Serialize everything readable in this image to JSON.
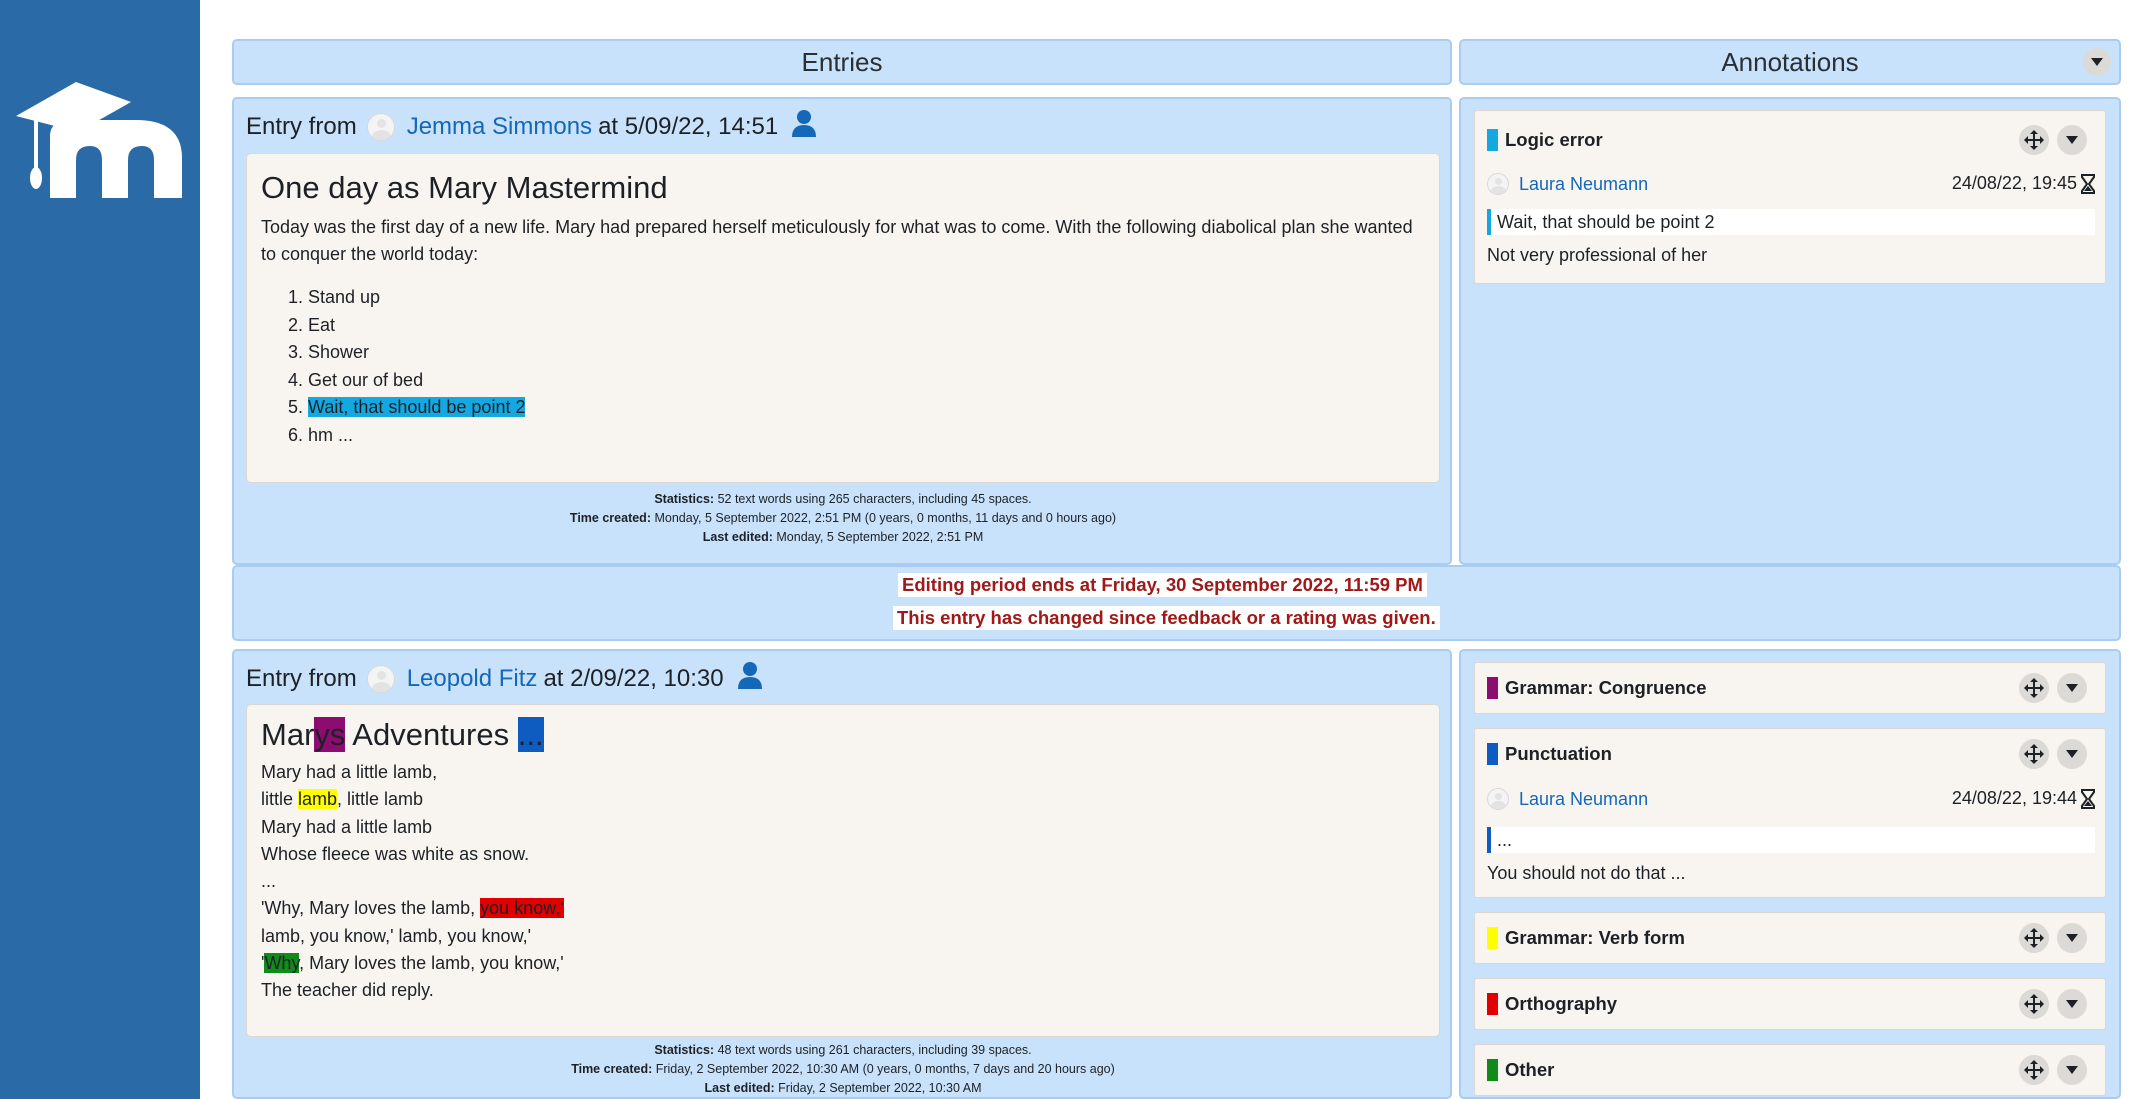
{
  "header": {
    "entries": "Entries",
    "annotations": "Annotations"
  },
  "entry1": {
    "prefix": "Entry from",
    "author": "Jemma Simmons",
    "when": "at 5/09/22, 14:51",
    "title": "One day as Mary Mastermind",
    "intro": "Today was the first day of a new life. Mary had prepared herself meticulously for what was to come. With the following diabolical plan she wanted to conquer the world today:",
    "items": [
      "Stand up",
      "Eat",
      "Shower",
      "Get our of bed",
      "Wait, that should be point 2",
      "hm ..."
    ],
    "stats": {
      "statistics_label": "Statistics:",
      "statistics": "52 text words using 265 characters, including 45 spaces.",
      "created_label": "Time created:",
      "created": "Monday, 5 September 2022, 2:51 PM (0 years, 0 months, 11 days and 0 hours ago)",
      "edited_label": "Last edited:",
      "edited": "Monday, 5 September 2022, 2:51 PM"
    }
  },
  "notices": {
    "editing_period": "Editing period ends at Friday, 30 September 2022, 11:59 PM",
    "changed": "This entry has changed since feedback or a rating was given."
  },
  "entry2": {
    "prefix": "Entry from",
    "author": "Leopold Fitz",
    "when": "at 2/09/22, 10:30",
    "title_a": "Mar",
    "title_b": "ys",
    "title_c": " Adventures ",
    "title_d": "...",
    "lines": {
      "l1": "Mary had a little lamb,",
      "l2a": "little ",
      "l2b": "lamb",
      "l2c": ", little lamb",
      "l3": "Mary had a little lamb",
      "l4": "Whose fleece was white as snow.",
      "l5": "...",
      "l6a": "'Why, Mary loves the lamb, ",
      "l6b": "you know,'",
      "l7": "lamb, you know,' lamb, you know,'",
      "l8a": "'",
      "l8b": "Why",
      "l8c": ", Mary loves the lamb, you know,'",
      "l9": "The teacher did reply."
    },
    "stats": {
      "statistics_label": "Statistics:",
      "statistics": "48 text words using 261 characters, including 39 spaces.",
      "created_label": "Time created:",
      "created": "Friday, 2 September 2022, 10:30 AM (0 years, 0 months, 7 days and 20 hours ago)",
      "edited_label": "Last edited:",
      "edited": "Friday, 2 September 2022, 10:30 AM"
    }
  },
  "annotations1": [
    {
      "type": "Logic error",
      "color": "#14a7e0",
      "user": "Laura Neumann",
      "date": "24/08/22, 19:45",
      "quote": "Wait, that should be point 2",
      "text": "Not very professional of her"
    }
  ],
  "annotations2": [
    {
      "type": "Grammar: Congruence",
      "color": "#8d0c6f"
    },
    {
      "type": "Punctuation",
      "color": "#0e5cc0",
      "user": "Laura Neumann",
      "date": "24/08/22, 19:44",
      "quote": "...",
      "text": "You should not do that ..."
    },
    {
      "type": "Grammar: Verb form",
      "color": "#ffff00"
    },
    {
      "type": "Orthography",
      "color": "#e00000"
    },
    {
      "type": "Other",
      "color": "#108a1a"
    }
  ],
  "colors": {
    "sidebar": "#2a6aa6",
    "panel": "#c8e2fb",
    "link": "#1567b8",
    "warning": "#a01818"
  }
}
